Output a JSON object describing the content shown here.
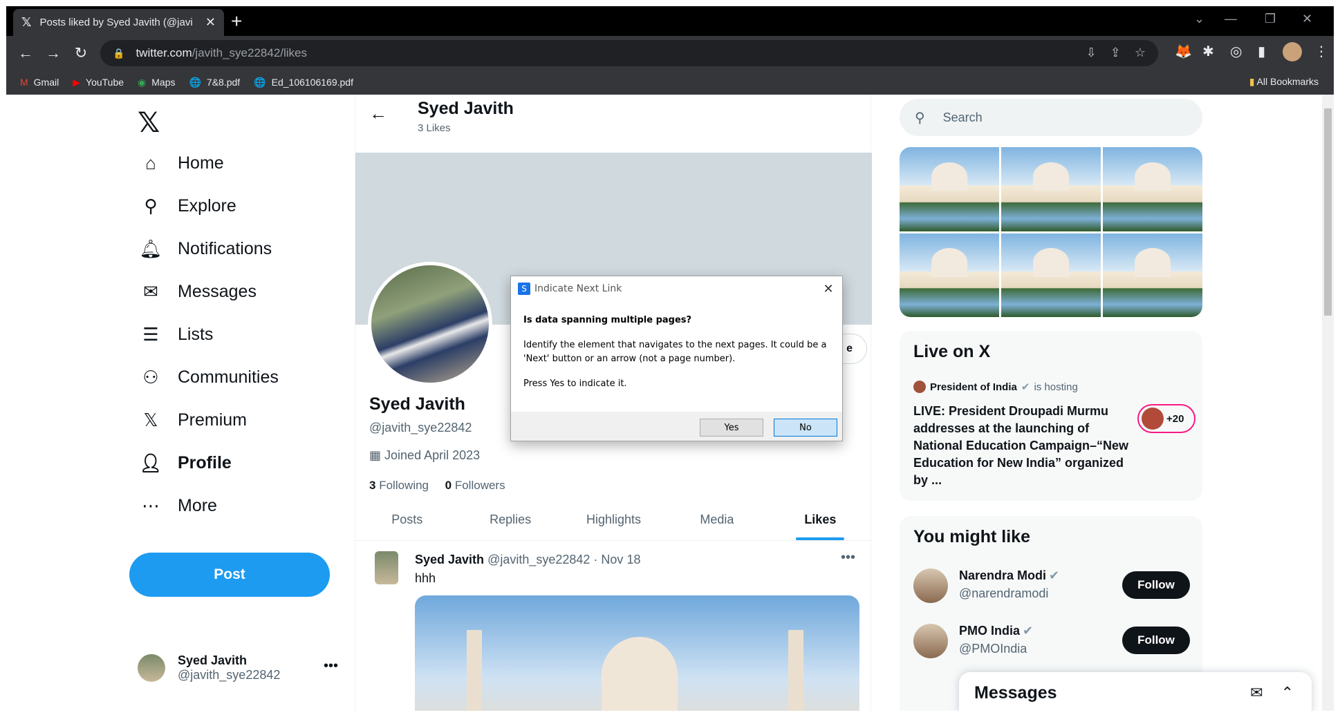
{
  "browser": {
    "tab_title": "Posts liked by Syed Javith (@javi",
    "tab_icon": "x-logo-icon",
    "url_host": "twitter.com",
    "url_path": "/javith_sye22842/likes",
    "bookmarks": [
      {
        "label": "Gmail",
        "icon": "gmail-icon"
      },
      {
        "label": "YouTube",
        "icon": "youtube-icon"
      },
      {
        "label": "Maps",
        "icon": "maps-icon"
      },
      {
        "label": "7&8.pdf",
        "icon": "globe-icon"
      },
      {
        "label": "Ed_106106169.pdf",
        "icon": "globe-icon"
      }
    ],
    "all_bookmarks": "All Bookmarks"
  },
  "nav": {
    "items": [
      {
        "label": "Home",
        "icon": "home-icon"
      },
      {
        "label": "Explore",
        "icon": "search-icon"
      },
      {
        "label": "Notifications",
        "icon": "bell-icon"
      },
      {
        "label": "Messages",
        "icon": "envelope-icon"
      },
      {
        "label": "Lists",
        "icon": "list-icon"
      },
      {
        "label": "Communities",
        "icon": "people-icon"
      },
      {
        "label": "Premium",
        "icon": "x-logo-icon"
      },
      {
        "label": "Profile",
        "icon": "person-icon"
      },
      {
        "label": "More",
        "icon": "more-circle-icon"
      }
    ],
    "post_button": "Post",
    "account_name": "Syed Javith",
    "account_handle": "@javith_sye22842"
  },
  "profile": {
    "header_name": "Syed Javith",
    "header_count": "3 Likes",
    "name": "Syed Javith",
    "handle": "@javith_sye22842",
    "joined": "Joined April 2023",
    "following_count": "3",
    "following_label": "Following",
    "followers_count": "0",
    "followers_label": "Followers",
    "edit_button": "e",
    "tabs": [
      "Posts",
      "Replies",
      "Highlights",
      "Media",
      "Likes"
    ],
    "active_tab": "Likes"
  },
  "post": {
    "author": "Syed Javith",
    "handle_date": "@javith_sye22842 · Nov 18",
    "text": "hhh"
  },
  "sidebar": {
    "search_placeholder": "Search",
    "live_title": "Live on X",
    "live_host": "President of India",
    "live_is_hosting": "is hosting",
    "live_desc": "LIVE: President Droupadi Murmu addresses at the launching of National Education Campaign–“New Education for New India” organized by ...",
    "live_badge": "+20",
    "might_like_title": "You might like",
    "suggestions": [
      {
        "name": "Narendra Modi",
        "handle": "@narendramodi",
        "button": "Follow"
      },
      {
        "name": "PMO India",
        "handle": "@PMOIndia",
        "button": "Follow"
      }
    ]
  },
  "messages_drawer": {
    "title": "Messages"
  },
  "dialog": {
    "title": "Indicate Next Link",
    "question": "Is data spanning multiple pages?",
    "description": "Identify the element that navigates to the next pages. It could be a 'Next' button or an arrow (not a page number).",
    "instruction": "Press Yes to indicate it.",
    "yes": "Yes",
    "no": "No"
  },
  "colors": {
    "accent": "#1d9bf0",
    "live_ring": "#f91880",
    "chrome_dark": "#35363a"
  }
}
